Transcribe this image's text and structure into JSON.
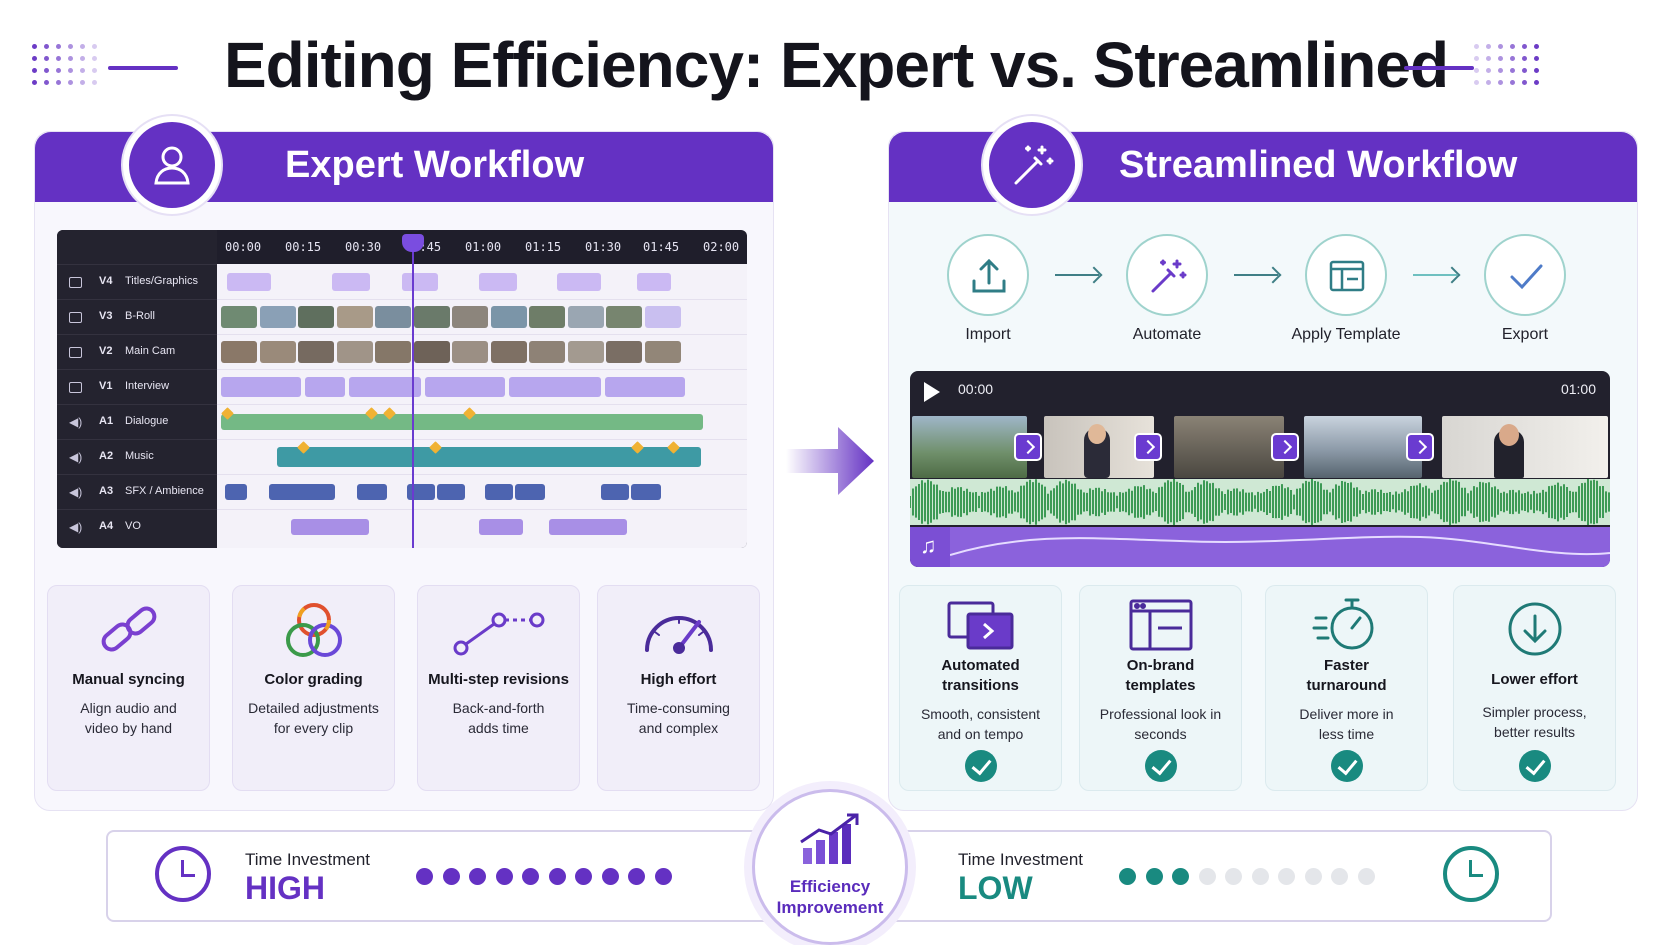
{
  "title": "Editing Efficiency: Expert vs. Streamlined",
  "colors": {
    "purple": "#6431c3",
    "teal": "#198a80",
    "green_wave": "#3d9a55"
  },
  "expert": {
    "header": "Expert Workflow",
    "icon": "user-icon",
    "timeline": {
      "times": [
        "00:00",
        "00:15",
        "00:30",
        "00:45",
        "01:00",
        "01:15",
        "01:30",
        "01:45",
        "02:00"
      ],
      "tracks": [
        {
          "code": "V4",
          "name": "Titles/Graphics",
          "icon": "film-icon"
        },
        {
          "code": "V3",
          "name": "B-Roll",
          "icon": "film-icon"
        },
        {
          "code": "V2",
          "name": "Main Cam",
          "icon": "film-icon"
        },
        {
          "code": "V1",
          "name": "Interview",
          "icon": "film-icon"
        },
        {
          "code": "A1",
          "name": "Dialogue",
          "icon": "speaker-icon"
        },
        {
          "code": "A2",
          "name": "Music",
          "icon": "speaker-icon"
        },
        {
          "code": "A3",
          "name": "SFX / Ambience",
          "icon": "speaker-icon"
        },
        {
          "code": "A4",
          "name": "VO",
          "icon": "speaker-icon"
        }
      ]
    },
    "cards": [
      {
        "title": "Manual syncing",
        "desc": "Align audio and video by hand",
        "icon": "link-icon"
      },
      {
        "title": "Color grading",
        "desc": "Detailed adjustments for every clip",
        "icon": "color-circles-icon"
      },
      {
        "title": "Multi-step revisions",
        "desc": "Back-and-forth adds time",
        "icon": "path-nodes-icon"
      },
      {
        "title": "High effort",
        "desc": "Time-consuming and complex",
        "icon": "gauge-icon"
      }
    ]
  },
  "streamlined": {
    "header": "Streamlined Workflow",
    "icon": "magic-wand-icon",
    "steps": [
      {
        "label": "Import",
        "icon": "upload-icon"
      },
      {
        "label": "Automate",
        "icon": "magic-wand-icon"
      },
      {
        "label": "Apply Template",
        "icon": "template-icon"
      },
      {
        "label": "Export",
        "icon": "check-icon"
      }
    ],
    "preview": {
      "start": "00:00",
      "end": "01:00"
    },
    "cards": [
      {
        "title": "Automated transitions",
        "desc": "Smooth, consistent and on tempo",
        "icon": "transition-icon"
      },
      {
        "title": "On-brand templates",
        "desc": "Professional look in seconds",
        "icon": "template-icon"
      },
      {
        "title": "Faster turnaround",
        "desc": "Deliver more in less time",
        "icon": "stopwatch-icon"
      },
      {
        "title": "Lower effort",
        "desc": "Simpler process, better results",
        "icon": "download-icon"
      }
    ]
  },
  "bottom": {
    "left": {
      "label": "Time Investment",
      "value": "HIGH",
      "level": 10,
      "of": 10
    },
    "center": "Efficiency Improvement",
    "right": {
      "label": "Time Investment",
      "value": "LOW",
      "level": 3,
      "of": 10
    }
  }
}
